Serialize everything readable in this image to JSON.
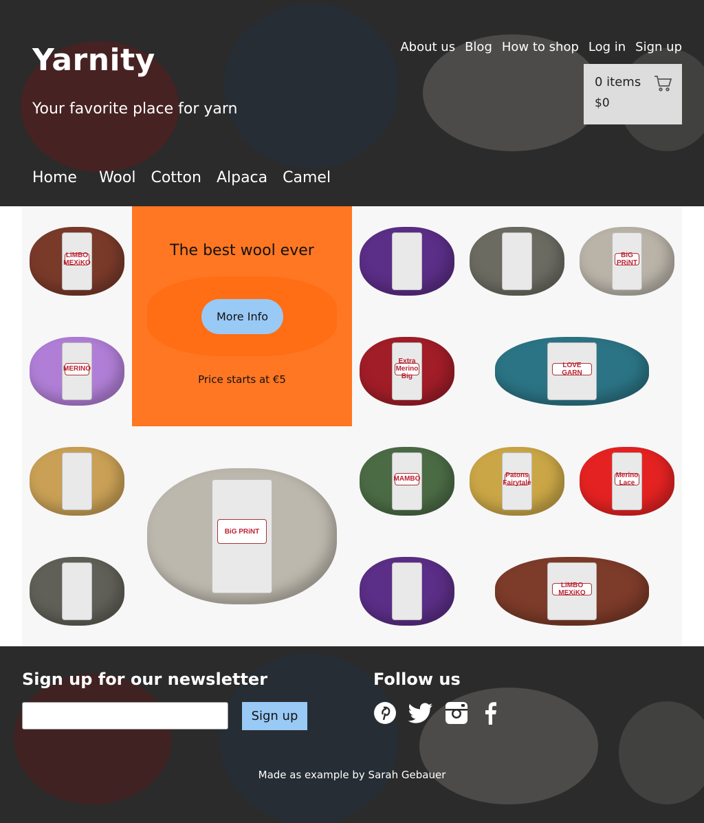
{
  "header": {
    "logo": "Yarnity",
    "tagline": "Your favorite place for yarn",
    "top_nav": [
      "About us",
      "Blog",
      "How to shop",
      "Log in",
      "Sign up"
    ],
    "cart": {
      "items": "0 items",
      "total": "$0",
      "icon": "shopping-cart-icon"
    },
    "main_nav": [
      "Home",
      "Wool",
      "Cotton",
      "Alpaca",
      "Camel"
    ]
  },
  "products": [
    {
      "label": "LiMBO MEXiKO",
      "color": "#7a3a2a"
    },
    {
      "label": "MERINO",
      "color": "#b07ed6"
    },
    {
      "label": "",
      "color": "#5b2e87"
    },
    {
      "label": "",
      "color": "#6b6b62"
    },
    {
      "label": "BiG PRiNT",
      "color": "#b9b3a8"
    },
    {
      "label": "Extra Merino Big",
      "color": "#a11d28"
    },
    {
      "label": "LOVE GARN",
      "color": "#2b7485"
    },
    {
      "label": "",
      "color": "#c9a055"
    },
    {
      "label": "BiG PRiNT",
      "color": "#bdb8ad"
    },
    {
      "label": "MAMBO",
      "color": "#4b6b45"
    },
    {
      "label": "Patons Fairytale",
      "color": "#caa646"
    },
    {
      "label": "Merino Lace",
      "color": "#e52222"
    },
    {
      "label": "",
      "color": "#606058"
    },
    {
      "label": "",
      "color": "#5b2e87"
    },
    {
      "label": "LiMBO MEXiKO",
      "color": "#7d3b29"
    }
  ],
  "promo": {
    "title": "The best wool ever",
    "button": "More Info",
    "price": "Price starts at €5"
  },
  "footer": {
    "newsletter_title": "Sign up for our newsletter",
    "newsletter_placeholder": "",
    "newsletter_button": "Sign up",
    "follow_title": "Follow us",
    "social_icons": [
      "pinterest-icon",
      "twitter-icon",
      "instagram-icon",
      "facebook-icon"
    ],
    "credit": "Made as example by Sarah Gebauer"
  },
  "colors": {
    "header_bg": "#2b2b2b",
    "promo_bg": "#ff7722",
    "button_bg": "#99c9f5",
    "cart_bg": "#dddddd"
  }
}
